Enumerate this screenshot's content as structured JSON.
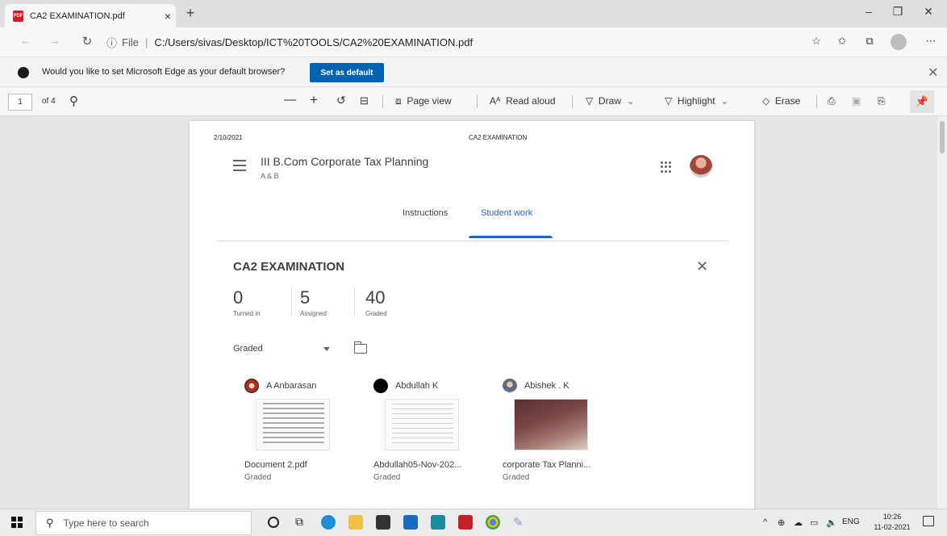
{
  "browser": {
    "tab_title": "CA2 EXAMINATION.pdf",
    "tab_close": "×",
    "new_tab": "+",
    "window_controls": [
      "–",
      "❐",
      "✕"
    ],
    "scheme_label": "File",
    "url": "C:/Users/sivas/Desktop/ICT%20TOOLS/CA2%20EXAMINATION.pdf"
  },
  "infobar": {
    "message": "Would you like to set Microsoft Edge as your default browser?",
    "button_label": "Set as default"
  },
  "pdf_toolbar": {
    "page_number": "1",
    "page_count": "of 4",
    "page_view": "Page view",
    "read_aloud": "Read aloud",
    "draw": "Draw",
    "highlight": "Highlight",
    "erase": "Erase"
  },
  "document": {
    "header_date": "2/10/2021",
    "header_title": "CA2 EXAMINATION",
    "course_name": "III B.Com Corporate Tax Planning",
    "course_section": "A & B",
    "tabs": [
      {
        "label": "Instructions"
      },
      {
        "label": "Student work"
      }
    ],
    "assignment_title": "CA2 EXAMINATION",
    "stats": [
      {
        "number": "0",
        "label": "Turned in"
      },
      {
        "number": "5",
        "label": "Assigned"
      },
      {
        "number": "40",
        "label": "Graded"
      }
    ],
    "filter_label": "Graded",
    "students": [
      {
        "name": "A Anbarasan",
        "file": "Document 2.pdf",
        "status": "Graded",
        "avatar_color": "#b0301f"
      },
      {
        "name": "Abdullah K",
        "file": "Abdullah05-Nov-202...",
        "status": "Graded",
        "avatar_color": "#000000"
      },
      {
        "name": "Abishek . K",
        "file": "corporate Tax Planni...",
        "status": "Graded",
        "avatar_color": "#7a8aa0"
      }
    ]
  },
  "taskbar": {
    "search_placeholder": "Type here to search",
    "language": "ENG",
    "time": "10:26",
    "date": "11-02-2021"
  },
  "colors": {
    "accent_blue": "#1967d2",
    "edge_button": "#0063b1"
  }
}
